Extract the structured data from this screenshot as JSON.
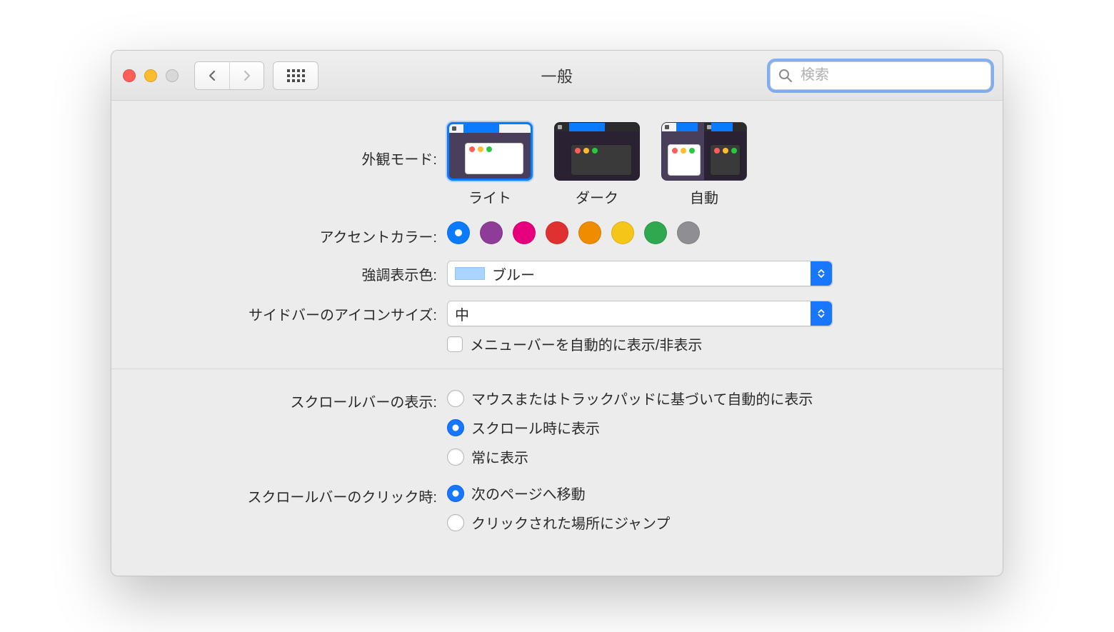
{
  "toolbar": {
    "title": "一般",
    "search_placeholder": "検索"
  },
  "appearance": {
    "label": "外観モード:",
    "options": [
      "ライト",
      "ダーク",
      "自動"
    ],
    "selected_index": 0
  },
  "accent": {
    "label": "アクセントカラー:",
    "colors": [
      "#0a7aff",
      "#8e3c97",
      "#e6007e",
      "#e03131",
      "#f08c00",
      "#f5c518",
      "#2fa84f",
      "#8e8e93"
    ],
    "selected_index": 0
  },
  "highlight": {
    "label": "強調表示色:",
    "value": "ブルー",
    "swatch": "#a9d4ff"
  },
  "sidebar_icon": {
    "label": "サイドバーのアイコンサイズ:",
    "value": "中"
  },
  "menubar_autohide": {
    "label": "メニューバーを自動的に表示/非表示",
    "checked": false
  },
  "scrollbars": {
    "label": "スクロールバーの表示:",
    "options": [
      "マウスまたはトラックパッドに基づいて自動的に表示",
      "スクロール時に表示",
      "常に表示"
    ],
    "selected_index": 1
  },
  "scrollbar_click": {
    "label": "スクロールバーのクリック時:",
    "options": [
      "次のページへ移動",
      "クリックされた場所にジャンプ"
    ],
    "selected_index": 0
  }
}
